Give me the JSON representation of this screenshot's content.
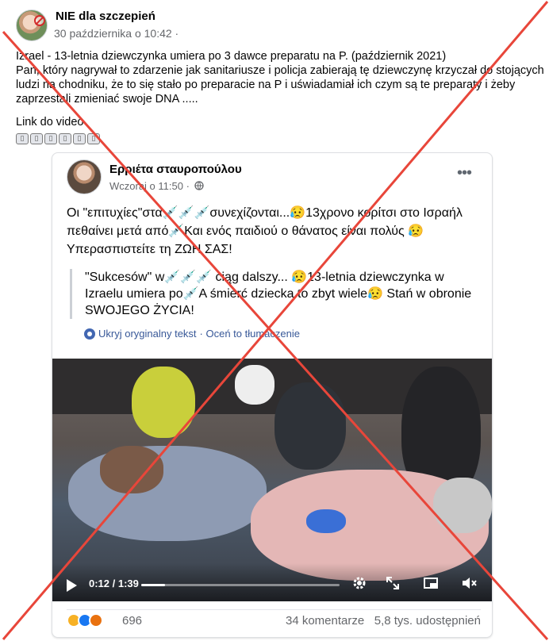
{
  "outer_post": {
    "author": "NIE dla szczepień",
    "timestamp": "30 października o 10:42 ·",
    "body_lines": [
      "Izrael - 13-letnia dziewczynka umiera po 3 dawce preparatu na P. (październik 2021)",
      "Pan, który nagrywał to zdarzenie jak sanitariusze i policja zabierają tę dziewczynę krzyczał do stojących ludzi na chodniku, że to się stało po preparacie na P i uświadamiał ich czym są te preparaty i żeby zaprzestali zmieniać swoje DNA ....."
    ],
    "link_label": "Link do video",
    "emoji_placeholders": [
      "▯",
      "▯",
      "▯",
      "▯",
      "▯",
      "▯"
    ]
  },
  "shared_post": {
    "author": "Ερριέτα σταυροπούλου",
    "timestamp": "Wczoraj o 11:50 ·",
    "greek_text": "Οι \"επιτυχίες\"στα💉💉💉συνεχίζονται...😥13χρονο κορίτσι στο Ισραήλ πεθαίνει μετά από💉Και ενός παιδιού ο θάνατος είναι πολύς 😥Υπερασπιστείτε τη ΖΩΗ ΣΑΣ!",
    "translation": "\"Sukcesów\" w💉💉💉 ciąg dalszy... 😥13-letnia dziewczynka w Izraelu umiera po💉A śmierć dziecka to zbyt wiele😥 Stań w obronie SWOJEGO ŻYCIA!",
    "hide_original": "Ukryj oryginalny tekst",
    "rate_translation": "· Oceń to tłumaczenie",
    "video": {
      "time": "0:12 / 1:39",
      "progress": 0.12
    },
    "reactions_count": "696",
    "comments": "34 komentarze",
    "shares": "5,8 tys. udostępnień"
  },
  "colors": {
    "overlay_x": "#e8463a",
    "link_blue": "#385898",
    "secondary_text": "#65676b"
  },
  "icons": [
    "shield-nosign-icon",
    "more-options-icon",
    "globe-icon",
    "gear-icon",
    "play-icon",
    "settings-icon",
    "fullscreen-icon",
    "pip-icon",
    "mute-icon",
    "sad-reaction-icon",
    "like-reaction-icon",
    "angry-reaction-icon"
  ]
}
